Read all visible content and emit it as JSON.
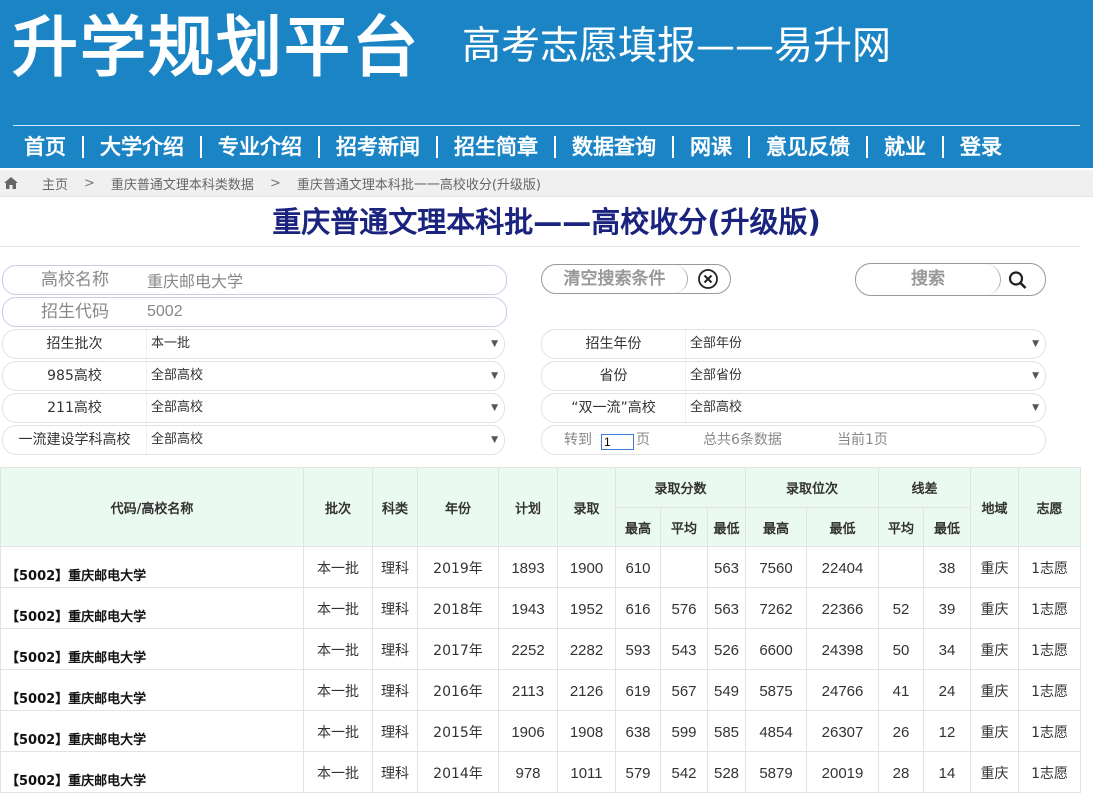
{
  "header": {
    "brand": "升学规划平台",
    "tagline": "高考志愿填报——易升网",
    "nav": [
      "首页",
      "大学介绍",
      "专业介绍",
      "招考新闻",
      "招生简章",
      "数据查询",
      "网课",
      "意见反馈",
      "就业",
      "登录"
    ]
  },
  "breadcrumb": {
    "icon": "home-icon",
    "items": [
      "主页",
      "重庆普通文理本科类数据",
      "重庆普通文理本科批一一高校收分(升级版)"
    ],
    "separator": ">"
  },
  "page_title": "重庆普通文理本科批——高校收分(升级版)",
  "search": {
    "school_name_label": "高校名称",
    "school_name_value": "重庆邮电大学",
    "code_label": "招生代码",
    "code_value": "5002",
    "clear_label": "清空搜索条件",
    "clear_icon": "close-circle-icon",
    "search_label": "搜索",
    "search_icon": "magnifier-icon"
  },
  "filters": {
    "batch": {
      "label": "招生批次",
      "value": "本一批"
    },
    "is985": {
      "label": "985高校",
      "value": "全部高校"
    },
    "is211": {
      "label": "211高校",
      "value": "全部高校"
    },
    "first_class_discipline": {
      "label": "一流建设学科高校",
      "value": "全部高校"
    },
    "year": {
      "label": "招生年份",
      "value": "全部年份"
    },
    "province": {
      "label": "省份",
      "value": "全部省份"
    },
    "double_first_class": {
      "label": "“双一流”高校",
      "value": "全部高校"
    }
  },
  "pager": {
    "goto_label": "转到",
    "page_value": "1",
    "page_suffix": "页",
    "total_text": "总共6条数据",
    "current_text": "当前1页"
  },
  "table": {
    "headers": {
      "name": "代码/高校名称",
      "batch": "批次",
      "subject": "科类",
      "year": "年份",
      "plan": "计划",
      "admitted": "录取",
      "score_group": "录取分数",
      "rank_group": "录取位次",
      "diff_group": "线差",
      "region": "地域",
      "wish": "志愿",
      "max": "最高",
      "avg": "平均",
      "min": "最低"
    },
    "rows": [
      {
        "name": "【5002】重庆邮电大学",
        "batch": "本一批",
        "subject": "理科",
        "year": "2019年",
        "plan": "1893",
        "admitted": "1900",
        "score_max": "610",
        "score_avg": "",
        "score_min": "563",
        "rank_max": "7560",
        "rank_min": "22404",
        "diff_avg": "",
        "diff_min": "38",
        "region": "重庆",
        "wish": "1志愿"
      },
      {
        "name": "【5002】重庆邮电大学",
        "batch": "本一批",
        "subject": "理科",
        "year": "2018年",
        "plan": "1943",
        "admitted": "1952",
        "score_max": "616",
        "score_avg": "576",
        "score_min": "563",
        "rank_max": "7262",
        "rank_min": "22366",
        "diff_avg": "52",
        "diff_min": "39",
        "region": "重庆",
        "wish": "1志愿"
      },
      {
        "name": "【5002】重庆邮电大学",
        "batch": "本一批",
        "subject": "理科",
        "year": "2017年",
        "plan": "2252",
        "admitted": "2282",
        "score_max": "593",
        "score_avg": "543",
        "score_min": "526",
        "rank_max": "6600",
        "rank_min": "24398",
        "diff_avg": "50",
        "diff_min": "34",
        "region": "重庆",
        "wish": "1志愿"
      },
      {
        "name": "【5002】重庆邮电大学",
        "batch": "本一批",
        "subject": "理科",
        "year": "2016年",
        "plan": "2113",
        "admitted": "2126",
        "score_max": "619",
        "score_avg": "567",
        "score_min": "549",
        "rank_max": "5875",
        "rank_min": "24766",
        "diff_avg": "41",
        "diff_min": "24",
        "region": "重庆",
        "wish": "1志愿"
      },
      {
        "name": "【5002】重庆邮电大学",
        "batch": "本一批",
        "subject": "理科",
        "year": "2015年",
        "plan": "1906",
        "admitted": "1908",
        "score_max": "638",
        "score_avg": "599",
        "score_min": "585",
        "rank_max": "4854",
        "rank_min": "26307",
        "diff_avg": "26",
        "diff_min": "12",
        "region": "重庆",
        "wish": "1志愿"
      },
      {
        "name": "【5002】重庆邮电大学",
        "batch": "本一批",
        "subject": "理科",
        "year": "2014年",
        "plan": "978",
        "admitted": "1011",
        "score_max": "579",
        "score_avg": "542",
        "score_min": "528",
        "rank_max": "5879",
        "rank_min": "20019",
        "diff_avg": "28",
        "diff_min": "14",
        "region": "重庆",
        "wish": "1志愿"
      }
    ]
  },
  "colors": {
    "header_bg": "#1a84c4",
    "title_color": "#1a237e",
    "table_header_bg": "#ebfaf0"
  }
}
